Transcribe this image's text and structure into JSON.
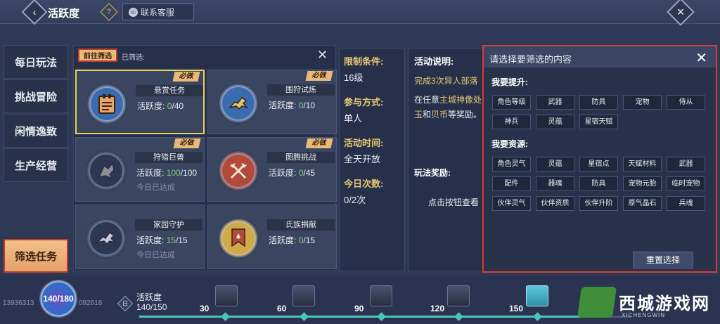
{
  "header": {
    "title": "活跃度",
    "help_icon": "?",
    "service_label": "联系客服"
  },
  "sidebar": {
    "items": [
      {
        "label": "每日玩法"
      },
      {
        "label": "挑战冒险"
      },
      {
        "label": "闲情逸致"
      },
      {
        "label": "生产经营"
      }
    ],
    "filter_label": "筛选任务"
  },
  "tasks": {
    "filter_button": "前往筛选",
    "selected_label": "已筛选:",
    "cards": [
      {
        "name": "悬赏任务",
        "activity_label": "活跃度:",
        "current": "0",
        "total": "/40",
        "badge": "必做",
        "done": ""
      },
      {
        "name": "围狩试炼",
        "activity_label": "活跃度:",
        "current": "0",
        "total": "/10",
        "badge": "必做",
        "done": ""
      },
      {
        "name": "狩猎巨兽",
        "activity_label": "活跃度:",
        "current": "100",
        "total": "/100",
        "badge": "必做",
        "done": "今日已达成"
      },
      {
        "name": "图腾挑战",
        "activity_label": "活跃度:",
        "current": "0",
        "total": "/45",
        "badge": "必做",
        "done": ""
      },
      {
        "name": "家园守护",
        "activity_label": "活跃度:",
        "current": "15",
        "total": "/15",
        "badge": "",
        "done": "今日已达成"
      },
      {
        "name": "氏族捐献",
        "activity_label": "活跃度:",
        "current": "0",
        "total": "/15",
        "badge": "",
        "done": ""
      }
    ]
  },
  "info": {
    "cond_label": "限制条件:",
    "cond_value": "16级",
    "join_label": "参与方式:",
    "join_value": "单人",
    "time_label": "活动时间:",
    "time_value": "全天开放",
    "count_label": "今日次数:",
    "count_value": "0/2次"
  },
  "desc": {
    "title": "活动说明:",
    "line1": "完成3次异人部落",
    "line2a": "在任意",
    "line2b": "主城神像处",
    "line3a": "玉",
    "line3b": "和",
    "line3c": "贝币",
    "line3d": "等奖励。",
    "reward_label": "玩法奖励:",
    "click_text": "点击按钮查看"
  },
  "popup": {
    "title": "请选择要筛选的内容",
    "section1": "我要提升:",
    "improve": [
      "角色等级",
      "武器",
      "防具",
      "宠物",
      "侍从",
      "神兵",
      "灵蕴",
      "星宿天赋"
    ],
    "section2": "我要资源:",
    "resources": [
      "角色灵气",
      "灵蕴",
      "星宿点",
      "天赋材料",
      "武器",
      "配件",
      "器魂",
      "防具",
      "宠物元胎",
      "临时宠物",
      "伙伴灵气",
      "伙伴资质",
      "伙伴升阶",
      "原气晶石",
      "兵魂"
    ],
    "reset": "重置选择"
  },
  "bottom": {
    "orb_value": "140/180",
    "uid_left": "13936313",
    "uid_right": "092616",
    "sun_icon": "日",
    "activity_label": "活跃度",
    "activity_value": "140/150",
    "progress": 0.93,
    "milestones": [
      "30",
      "60",
      "90",
      "120",
      "150"
    ]
  },
  "watermark": {
    "text": "西城游戏网",
    "sub": "XICHENGWIN"
  }
}
